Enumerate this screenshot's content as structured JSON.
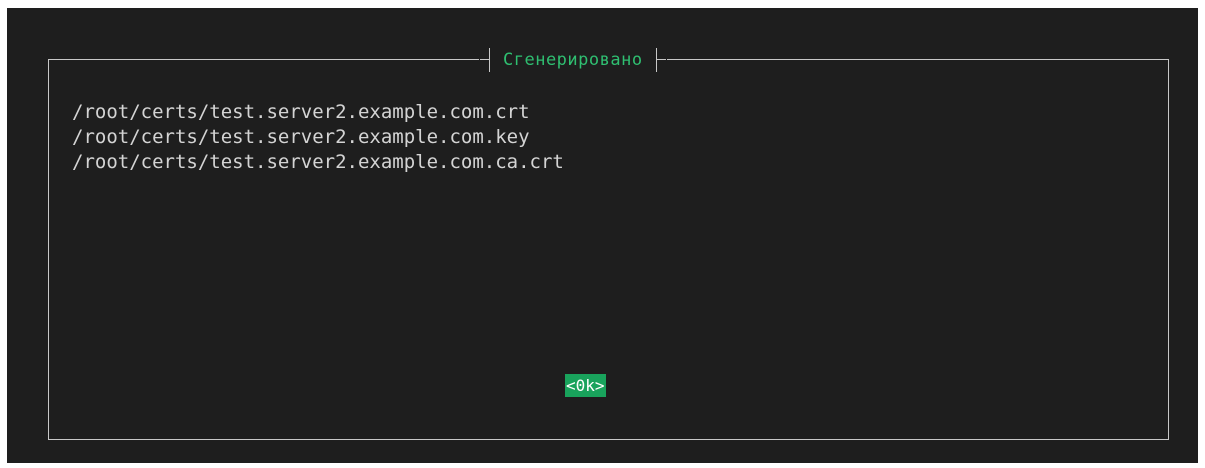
{
  "dialog": {
    "title": "Сгенерировано",
    "files": [
      "/root/certs/test.server2.example.com.crt",
      "/root/certs/test.server2.example.com.key",
      "/root/certs/test.server2.example.com.ca.crt"
    ],
    "ok_label": "<0k>"
  },
  "colors": {
    "background": "#1e1e1e",
    "border": "#c8c8c8",
    "title": "#2fbf71",
    "text": "#d4d4d4",
    "button_bg": "#19a35c",
    "button_text": "#ffffff"
  }
}
